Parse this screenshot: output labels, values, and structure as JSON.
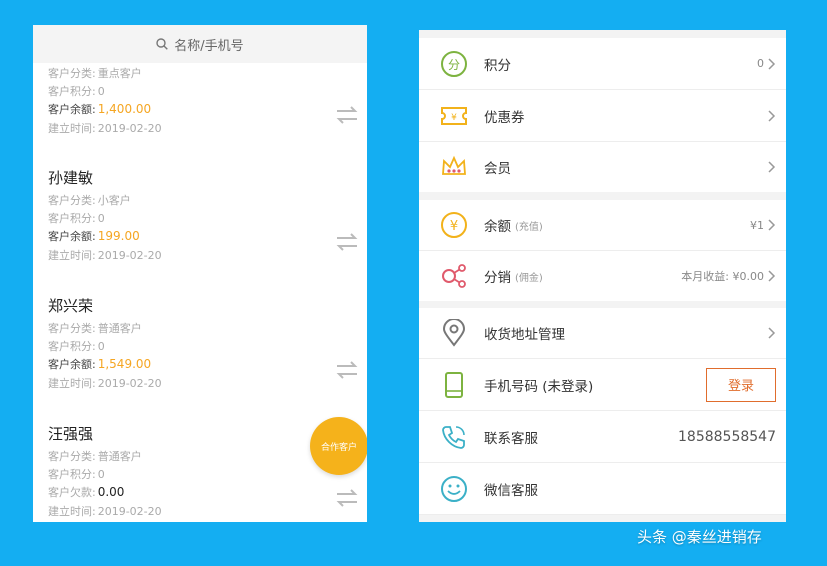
{
  "left": {
    "search_placeholder": "名称/手机号",
    "customers": [
      {
        "name": "",
        "category_label": "客户分类:",
        "category": "重点客户",
        "points_label": "客户积分:",
        "points": "0",
        "balance_label": "客户余额:",
        "balance": "1,400.00",
        "created_label": "建立时间:",
        "created": "2019-02-20"
      },
      {
        "name": "孙建敏",
        "category_label": "客户分类:",
        "category": "小客户",
        "points_label": "客户积分:",
        "points": "0",
        "balance_label": "客户余额:",
        "balance": "199.00",
        "created_label": "建立时间:",
        "created": "2019-02-20"
      },
      {
        "name": "郑兴荣",
        "category_label": "客户分类:",
        "category": "普通客户",
        "points_label": "客户积分:",
        "points": "0",
        "balance_label": "客户余额:",
        "balance": "1,549.00",
        "created_label": "建立时间:",
        "created": "2019-02-20"
      },
      {
        "name": "汪强强",
        "category_label": "客户分类:",
        "category": "普通客户",
        "points_label": "客户积分:",
        "points": "0",
        "balance_label": "客户欠款:",
        "balance": "0.00",
        "created_label": "建立时间:",
        "created": "2019-02-20"
      }
    ],
    "fab_label": "合作客户"
  },
  "right": {
    "points": {
      "label": "积分",
      "value": "0"
    },
    "coupons": {
      "label": "优惠券"
    },
    "member": {
      "label": "会员"
    },
    "balance": {
      "label": "余额",
      "sub": "(充值)",
      "value": "¥1"
    },
    "distribution": {
      "label": "分销",
      "sub": "(佣金)",
      "value": "本月收益: ¥0.00"
    },
    "address": {
      "label": "收货地址管理"
    },
    "phone": {
      "label": "手机号码 (未登录)",
      "login_button": "登录"
    },
    "service": {
      "label": "联系客服",
      "phone": "18588558547"
    },
    "wechat": {
      "label": "微信客服"
    }
  },
  "watermark": "头条 @秦丝进销存",
  "colors": {
    "background": "#14aef2",
    "gold": "#f5a623",
    "fab": "#f5b21b",
    "login": "#e06d2d",
    "icon_green": "#7db340",
    "icon_yellow": "#f2b21b",
    "icon_pink": "#e05a6c",
    "icon_gray": "#777777",
    "icon_teal": "#3bb0c7"
  }
}
